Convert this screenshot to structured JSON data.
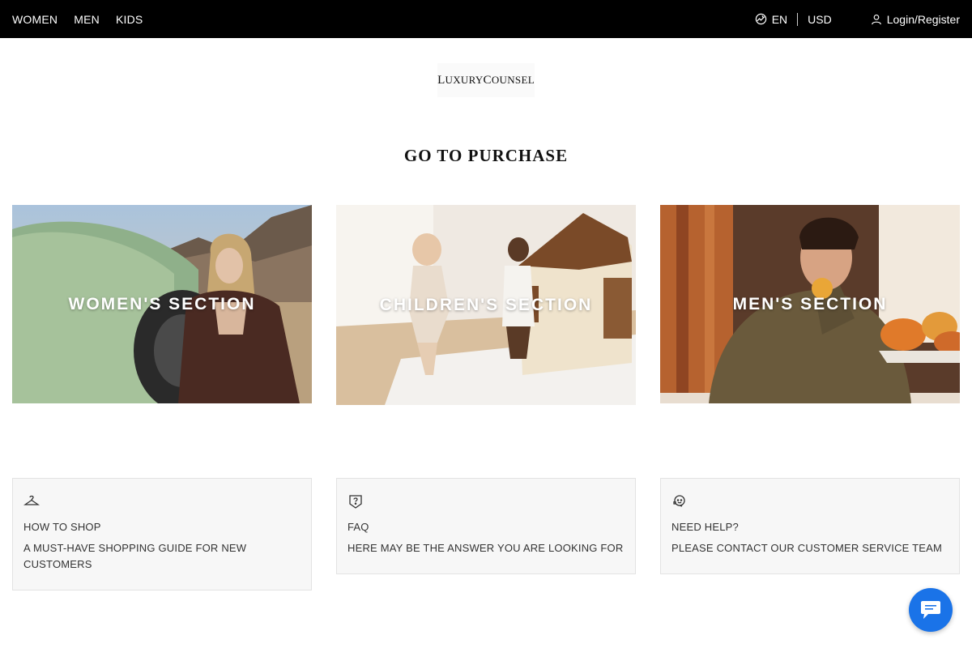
{
  "topbar": {
    "nav": [
      "WOMEN",
      "MEN",
      "KIDS"
    ],
    "language": "EN",
    "currency": "USD",
    "login": "Login/Register",
    "icons": {
      "language": "globe-icon",
      "login": "user-icon"
    }
  },
  "logo": {
    "first_cap": "L",
    "first_rest": "UXURY",
    "second_cap": "C",
    "second_rest": "OUNSEL"
  },
  "page_title": "GO TO PURCHASE",
  "sections": [
    {
      "label": "WOMEN'S SECTION"
    },
    {
      "label": "CHILDREN'S SECTION"
    },
    {
      "label": "MEN'S SECTION"
    }
  ],
  "info_boxes": [
    {
      "icon": "hanger-icon",
      "heading": "HOW TO SHOP",
      "description": "A MUST-HAVE SHOPPING GUIDE FOR NEW CUSTOMERS"
    },
    {
      "icon": "question-icon",
      "heading": "FAQ",
      "description": "HERE MAY BE THE ANSWER YOU ARE LOOKING FOR"
    },
    {
      "icon": "headset-icon",
      "heading": "NEED HELP?",
      "description": "PLEASE CONTACT OUR CUSTOMER SERVICE TEAM"
    }
  ],
  "chat": {
    "icon": "chat-icon",
    "color": "#1a73e8"
  }
}
